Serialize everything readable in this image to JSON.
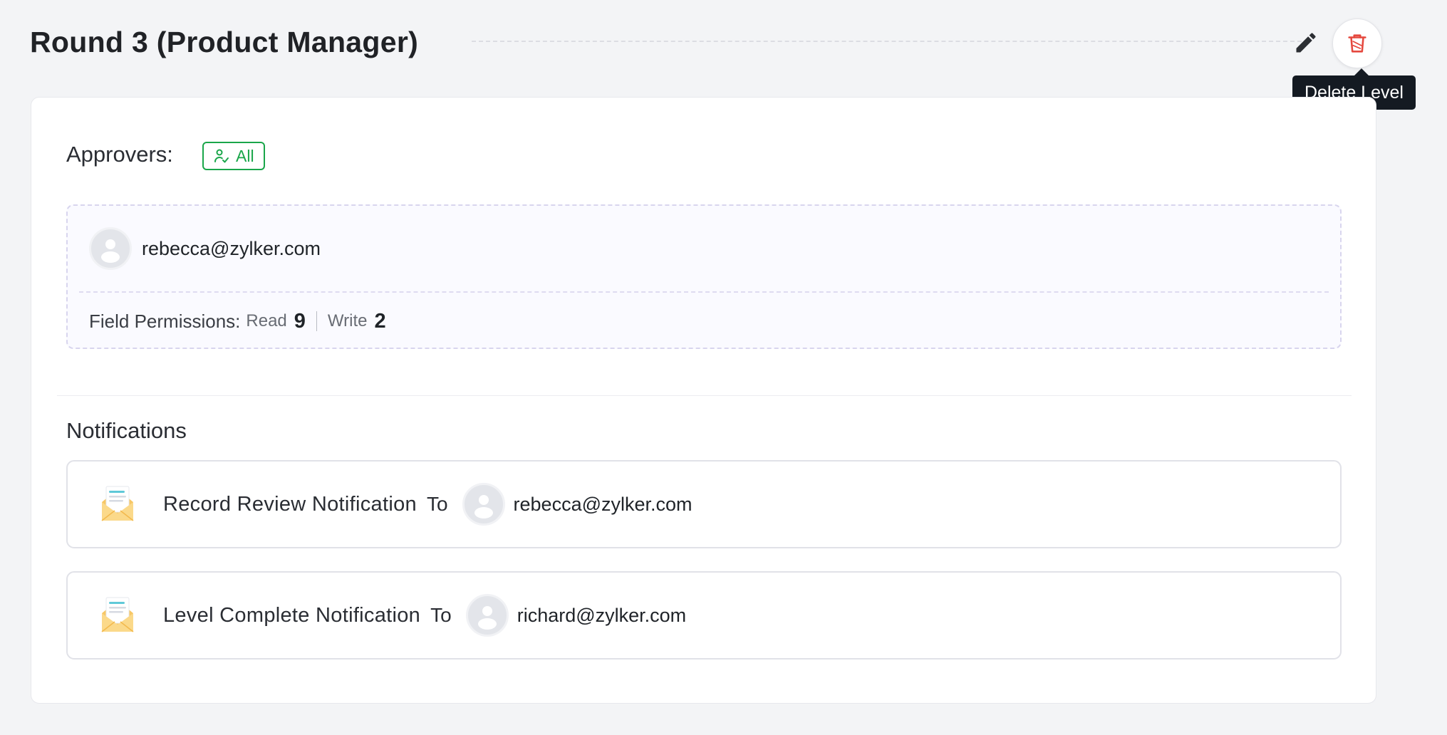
{
  "level": {
    "title": "Round 3 (Product Manager)",
    "edit_icon": "pencil-icon",
    "delete_icon": "trash-icon",
    "tooltip": "Delete Level"
  },
  "approvers": {
    "label": "Approvers:",
    "badge_label": "All",
    "badge_icon": "user-check-icon",
    "badge_color": "#1aa64a",
    "approver_email": "rebecca@zylker.com",
    "permissions": {
      "label": "Field Permissions:",
      "read_label": "Read",
      "read_count": "9",
      "write_label": "Write",
      "write_count": "2"
    }
  },
  "notifications": {
    "title": "Notifications",
    "items": [
      {
        "name": "Record Review Notification",
        "to_label": "To",
        "recipient": "rebecca@zylker.com",
        "icon": "open-envelope-icon"
      },
      {
        "name": "Level Complete Notification",
        "to_label": "To",
        "recipient": "richard@zylker.com",
        "icon": "open-envelope-icon"
      }
    ]
  },
  "colors": {
    "delete": "#e5483e",
    "accent_green": "#1aa64a",
    "tooltip_bg": "#141a22"
  }
}
